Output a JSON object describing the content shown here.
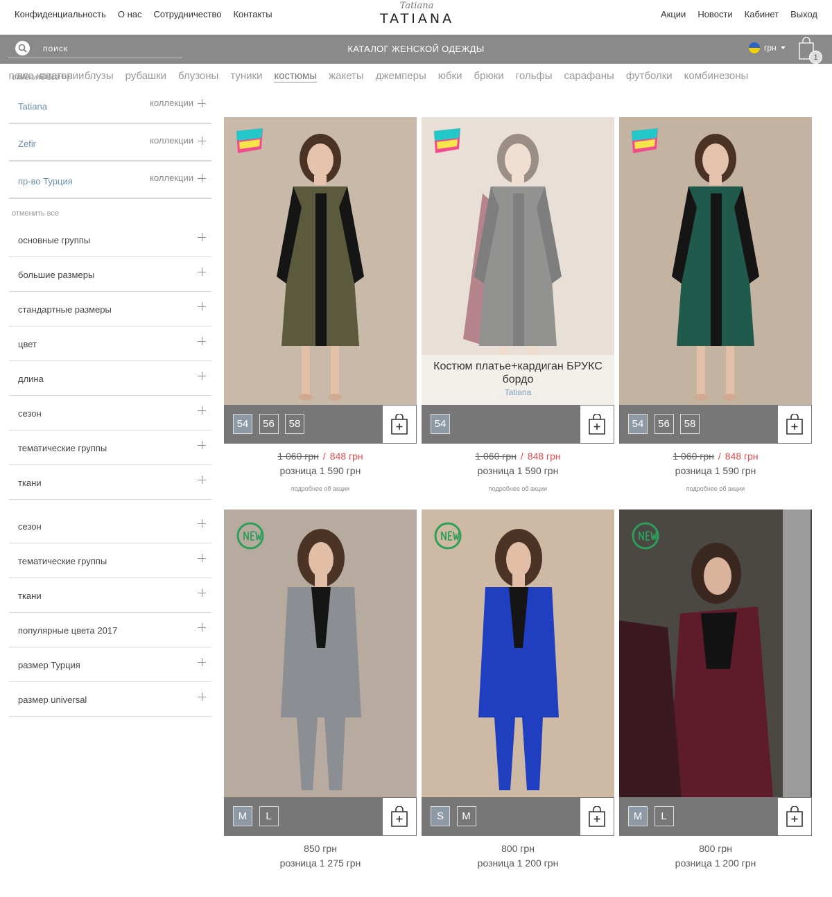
{
  "topnav": {
    "left": [
      "Конфиденциальность",
      "О нас",
      "Сотрудничество",
      "Контакты"
    ],
    "right": [
      "Акции",
      "Новости",
      "Кабинет",
      "Выход"
    ],
    "logo_script": "Tatiana",
    "logo_main": "TATIANA"
  },
  "searchbar": {
    "placeholder": "поиск",
    "catalog_title": "КАТАЛОГ ЖЕНСКОЙ ОДЕЖДЫ",
    "currency": "грн",
    "cart_count": "1"
  },
  "categories": {
    "first": "все категории",
    "items": [
      "sale",
      "new",
      "платья",
      "блузы",
      "рубашки",
      "блузоны",
      "туники",
      "костюмы",
      "жакеты",
      "джемперы",
      "юбки",
      "брюки",
      "гольфы",
      "сарафаны",
      "футболки",
      "комбинезоны"
    ],
    "active": "костюмы"
  },
  "sidebar": {
    "cancel_all_top": "отменить все",
    "collections": [
      {
        "name": "Tatiana",
        "action": "коллекции"
      },
      {
        "name": "Zefir",
        "action": "коллекции"
      },
      {
        "name": "пр-во Турция",
        "action": "коллекции"
      }
    ],
    "cancel_all": "отменить все",
    "filters_group1": [
      "основные группы",
      "большие размеры",
      "стандартные размеры",
      "цвет",
      "длина",
      "сезон",
      "тематические группы",
      "ткани"
    ],
    "filters_group2": [
      "сезон",
      "тематические группы",
      "ткани",
      "популярные цвета 2017",
      "размер Турция",
      "размер universal"
    ]
  },
  "products": [
    {
      "badge": "spring-boom",
      "sizes": [
        "54",
        "56",
        "58"
      ],
      "old_price": "1 060 грн",
      "sep": "/",
      "new_price": "848 грн",
      "retail": "розница 1 590 грн",
      "promo": "подробнее об акции",
      "caption": null,
      "brand": null
    },
    {
      "badge": "spring-boom",
      "sizes": [
        "54"
      ],
      "old_price": "1 060 грн",
      "sep": "/",
      "new_price": "848 грн",
      "retail": "розница 1 590 грн",
      "promo": "подробнее об акции",
      "caption": "Костюм платье+кардиган БРУКС бордо",
      "brand": "Tatiana"
    },
    {
      "badge": "spring-boom",
      "sizes": [
        "54",
        "56",
        "58"
      ],
      "old_price": "1 060 грн",
      "sep": "/",
      "new_price": "848 грн",
      "retail": "розница 1 590 грн",
      "promo": "подробнее об акции",
      "caption": null,
      "brand": null
    },
    {
      "badge": "new",
      "sizes": [
        "M",
        "L"
      ],
      "price": "850 грн",
      "retail": "розница 1 275 грн"
    },
    {
      "badge": "new",
      "sizes": [
        "S",
        "M"
      ],
      "price": "800 грн",
      "retail": "розница 1 200 грн"
    },
    {
      "badge": "new",
      "sizes": [
        "M",
        "L"
      ],
      "price": "800 грн",
      "retail": "розница 1 200 грн"
    }
  ],
  "colors": {
    "grey_bar": "#8a8a8a",
    "size_bar": "#777777",
    "sale_red": "#e04b4b",
    "new_green": "#2e9e5b",
    "link_blue": "#6a8fae"
  }
}
